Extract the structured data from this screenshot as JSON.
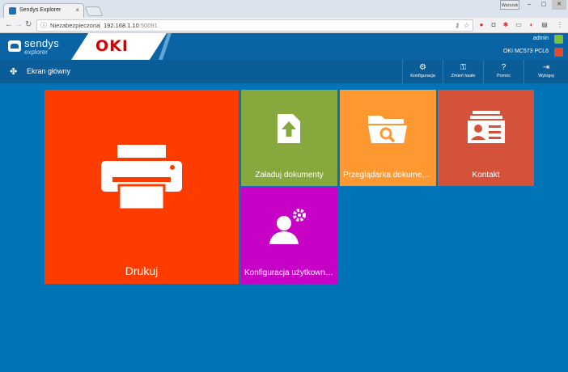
{
  "browser": {
    "tab_title": "Sendys Explorer",
    "tab_close": "×",
    "window_user": "Wszczuk",
    "window_min": "–",
    "window_max": "▢",
    "window_close": "✕",
    "nav_back": "←",
    "nav_forward": "→",
    "nav_reload": "↻",
    "security_label": "Niezabezpieczona",
    "url_host": "192.168.1.10",
    "url_port": ":50091"
  },
  "app": {
    "brand_line1": "sendys",
    "brand_line2": "explorer",
    "vendor_logo": "OKI",
    "username": "admin",
    "printer_model": "OKI MC573 PCL6",
    "home_label": "Ekran główny",
    "toolbar": [
      {
        "label": "Konfiguracja",
        "icon": "user-gear-icon"
      },
      {
        "label": "Zmień hasło",
        "icon": "key-icon"
      },
      {
        "label": "Pomoc",
        "icon": "help-icon"
      },
      {
        "label": "Wyloguj",
        "icon": "logout-icon"
      }
    ],
    "tiles": {
      "print": "Drukuj",
      "upload": "Załaduj dokumenty",
      "browser": "Przeglądarka dokumen...",
      "contact": "Kontakt",
      "user_config": "Konfiguracja użytkownika"
    }
  },
  "colors": {
    "app_bg": "#0173b7",
    "print_tile": "#ff3c00",
    "upload_tile": "#86a83d",
    "browser_tile": "#fe9931",
    "contact_tile": "#d45239",
    "user_config_tile": "#c701c6"
  }
}
